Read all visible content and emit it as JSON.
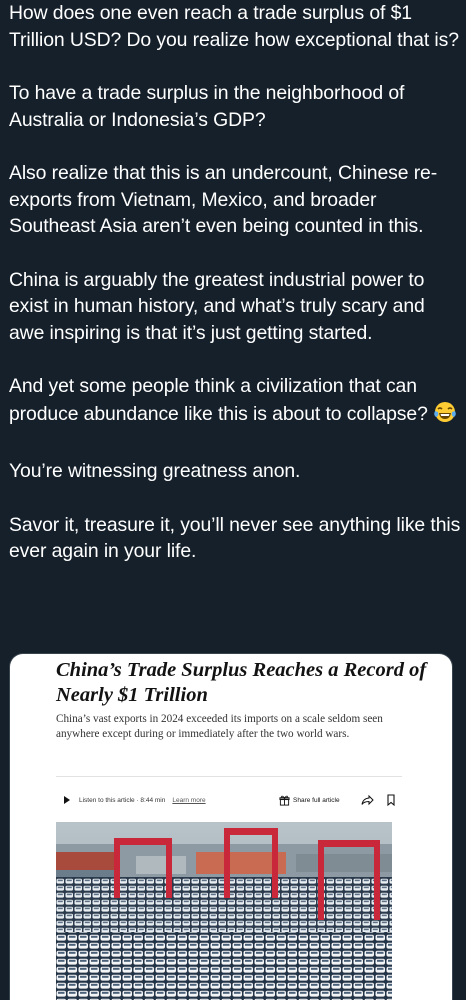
{
  "post": {
    "paragraphs": [
      "How does one even reach a trade surplus of $1 Trillion USD? Do you realize how exceptional that is?",
      "To have a trade surplus in the neighborhood of Australia or Indonesia’s GDP?",
      "Also realize that this is an undercount, Chinese re- exports from Vietnam, Mexico, and broader Southeast Asia aren’t even being counted in this.",
      "China is arguably the greatest industrial power to exist in human history, and what’s truly scary and awe inspiring is that it’s just getting started.",
      "And yet some people think a civilization that can produce abundance like this is about to collapse?",
      "You’re witnessing greatness anon.",
      "Savor it, treasure it, you’ll never see anything like this ever again in your life."
    ],
    "emoji": "tears-of-joy-emoji"
  },
  "article": {
    "headline": "China’s Trade Surplus Reaches a Record of Nearly $1 Trillion",
    "summary": "China’s vast exports in 2024 exceeded its imports on a scale seldom seen anywhere except during or immediately after the two world wars.",
    "listen_label": "Listen to this article · 8:44 min",
    "learn_more": "Learn more",
    "share_label": "Share full article",
    "photo_desc_icon": "port-with-cars-photo"
  }
}
